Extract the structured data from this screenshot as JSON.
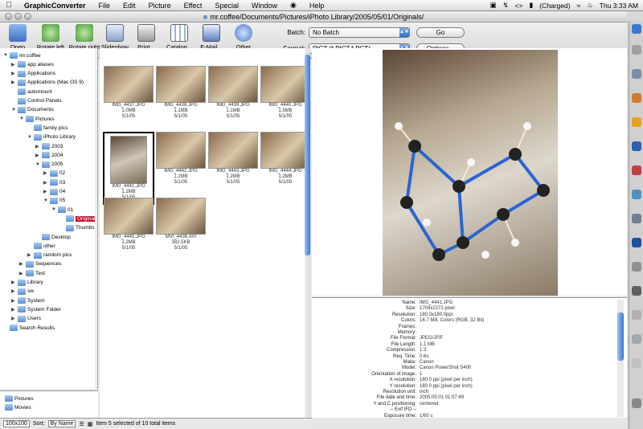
{
  "menubar": {
    "apple": "",
    "app": "GraphicConverter",
    "items": [
      "File",
      "Edit",
      "Picture",
      "Effect",
      "Special",
      "Window",
      "Help"
    ],
    "battery": "(Charged)",
    "clock": "Thu 3:33 AM"
  },
  "window": {
    "title": "mr.coffee/Documents/Pictures/iPhoto Library/2005/05/01/Originals/"
  },
  "toolbar": {
    "open": "Open",
    "rotate_left": "Rotate left",
    "rotate_right": "Rotate right",
    "slideshow": "Slideshow",
    "print": "Print...",
    "catalog": "Catalog...",
    "email": "E-Mail...",
    "other": "Other"
  },
  "batch": {
    "label": "Batch:",
    "value": "No Batch",
    "go": "Go"
  },
  "format": {
    "label": "Format:",
    "value": "PICT (*.PICT,*.PCT)",
    "options": "Options..."
  },
  "tree": [
    {
      "label": "mr.coffee",
      "depth": 0,
      "open": true
    },
    {
      "label": "app aliases",
      "depth": 1,
      "open": false
    },
    {
      "label": "Applications",
      "depth": 1,
      "open": false
    },
    {
      "label": "Applications (Mac OS 9)",
      "depth": 1,
      "open": false
    },
    {
      "label": "automount",
      "depth": 1,
      "open": null
    },
    {
      "label": "Control Panels",
      "depth": 1,
      "open": null
    },
    {
      "label": "Documents",
      "depth": 1,
      "open": true
    },
    {
      "label": "Pictures",
      "depth": 2,
      "open": true
    },
    {
      "label": "family pics",
      "depth": 3,
      "open": null
    },
    {
      "label": "iPhoto Library",
      "depth": 3,
      "open": true
    },
    {
      "label": "2003",
      "depth": 4,
      "open": false
    },
    {
      "label": "2004",
      "depth": 4,
      "open": false
    },
    {
      "label": "2005",
      "depth": 4,
      "open": true
    },
    {
      "label": "02",
      "depth": 5,
      "open": false
    },
    {
      "label": "03",
      "depth": 5,
      "open": false
    },
    {
      "label": "04",
      "depth": 5,
      "open": false
    },
    {
      "label": "05",
      "depth": 5,
      "open": true
    },
    {
      "label": "01",
      "depth": 6,
      "open": true
    },
    {
      "label": "Originals",
      "depth": 7,
      "open": null,
      "selected": true
    },
    {
      "label": "Thumbs",
      "depth": 7,
      "open": null
    },
    {
      "label": "Desktop",
      "depth": 4,
      "open": null
    },
    {
      "label": "other",
      "depth": 3,
      "open": null
    },
    {
      "label": "random pics",
      "depth": 3,
      "open": false
    },
    {
      "label": "Sequences",
      "depth": 2,
      "open": false
    },
    {
      "label": "Test",
      "depth": 2,
      "open": false
    },
    {
      "label": "Library",
      "depth": 1,
      "open": false
    },
    {
      "label": "sw",
      "depth": 1,
      "open": false
    },
    {
      "label": "System",
      "depth": 1,
      "open": false
    },
    {
      "label": "System Folder",
      "depth": 1,
      "open": false
    },
    {
      "label": "Users",
      "depth": 1,
      "open": false
    },
    {
      "label": "Search Results",
      "depth": 0,
      "open": null
    }
  ],
  "favorites": [
    "Pictures",
    "Movies"
  ],
  "thumbnails": [
    {
      "name": "IMG_4437.JPG",
      "size": "1.0MB",
      "date": "5/1/05"
    },
    {
      "name": "IMG_4438.JPG",
      "size": "1.1MB",
      "date": "5/1/05"
    },
    {
      "name": "IMG_4439.JPG",
      "size": "1.1MB",
      "date": "5/1/05"
    },
    {
      "name": "IMG_4440.JPG",
      "size": "1.5MB",
      "date": "5/1/05"
    },
    {
      "name": "IMG_4441.JPG",
      "size": "1.2MB",
      "date": "5/1/05",
      "selected": true
    },
    {
      "name": "IMG_4442.JPG",
      "size": "1.2MB",
      "date": "5/1/05"
    },
    {
      "name": "IMG_4443.JPG",
      "size": "1.2MB",
      "date": "5/1/05"
    },
    {
      "name": "IMG_4444.JPG",
      "size": "1.2MB",
      "date": "5/1/05"
    },
    {
      "name": "IMG_4445.JPG",
      "size": "1.2MB",
      "date": "5/1/05"
    },
    {
      "name": "MVI_4436.AVI",
      "size": "382.5KB",
      "date": "5/1/05"
    }
  ],
  "info": [
    {
      "k": "Name:",
      "v": "IMG_4441.JPG"
    },
    {
      "k": "Size:",
      "v": "1704x2272 pixel"
    },
    {
      "k": "Resolution:",
      "v": "180.0x180.0ppi"
    },
    {
      "k": "Colors:",
      "v": "16.7 Mill. Colors (RGB, 32 Bit)"
    },
    {
      "k": "Frames:",
      "v": ""
    },
    {
      "k": "Memory:",
      "v": ""
    },
    {
      "k": "File Format:",
      "v": "JPEG/JFIF"
    },
    {
      "k": "File Length:",
      "v": "1.1 MB"
    },
    {
      "k": "Compression:",
      "v": "1:3"
    },
    {
      "k": "Req. Time:",
      "v": "0.6s"
    },
    {
      "k": "Make:",
      "v": "Canon"
    },
    {
      "k": "Model:",
      "v": "Canon PowerShot S400"
    },
    {
      "k": "Orientation of image:",
      "v": "1"
    },
    {
      "k": "X resolution:",
      "v": "180.0 ppi (pixel per inch)"
    },
    {
      "k": "Y resolution:",
      "v": "180.0 ppi (pixel per inch)"
    },
    {
      "k": "Resolution unit:",
      "v": "inch"
    },
    {
      "k": "File date and time:",
      "v": "2005:05:01 01:07:49"
    },
    {
      "k": "Y and C positioning:",
      "v": "centered"
    },
    {
      "k": "-- Exif IFD --",
      "v": ""
    },
    {
      "k": "Exposure time:",
      "v": "1/60 s"
    }
  ],
  "status": {
    "zoom": "100x100",
    "sort_label": "Sort:",
    "sort_value": "By Name",
    "text": "Item 5 selected of 10 total items"
  }
}
